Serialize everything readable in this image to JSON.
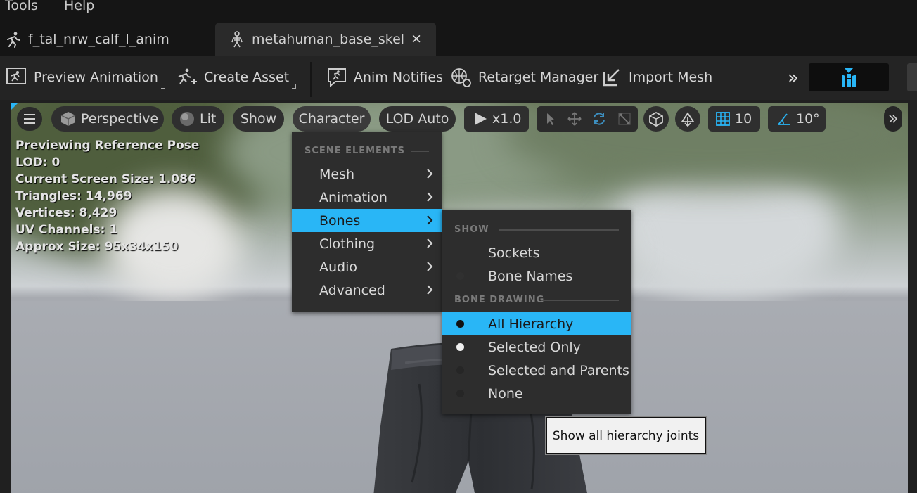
{
  "menubar": {
    "items": [
      "Tools",
      "Help"
    ]
  },
  "tabs": [
    {
      "label": "f_tal_nrw_calf_l_anim",
      "icon": "running-figure-icon",
      "active": false
    },
    {
      "label": "metahuman_base_skel",
      "icon": "skeleton-icon",
      "active": true,
      "close": "×"
    }
  ],
  "toolbar": {
    "preview_animation": "Preview Animation",
    "create_asset": "Create Asset",
    "anim_notifies": "Anim Notifies",
    "retarget_manager": "Retarget Manager",
    "import_mesh": "Import Mesh",
    "overflow": "»"
  },
  "viewport_toolbar": {
    "perspective": "Perspective",
    "lit": "Lit",
    "show": "Show",
    "character": "Character",
    "lod": "LOD Auto",
    "play_rate": "x1.0",
    "grid_size": "10",
    "rotation_snap": "10°"
  },
  "stats": [
    "Previewing Reference Pose",
    "LOD: 0",
    "Current Screen Size: 1.086",
    "Triangles: 14,969",
    "Vertices: 8,429",
    "UV Channels: 1",
    "Approx Size: 95x34x150"
  ],
  "character_menu": {
    "section": "SCENE ELEMENTS",
    "items": [
      "Mesh",
      "Animation",
      "Bones",
      "Clothing",
      "Audio",
      "Advanced"
    ],
    "highlighted": "Bones"
  },
  "bones_menu": {
    "show_section": "SHOW",
    "show_items": [
      "Sockets",
      "Bone Names"
    ],
    "drawing_section": "BONE DRAWING",
    "drawing_items": [
      "All Hierarchy",
      "Selected Only",
      "Selected and Parents",
      "None"
    ],
    "selected": "All Hierarchy"
  },
  "tooltip": "Show all hierarchy joints",
  "colors": {
    "accent": "#29b6f6",
    "menu_bg": "#2d2d2d",
    "toolbar_bg": "#242424"
  }
}
